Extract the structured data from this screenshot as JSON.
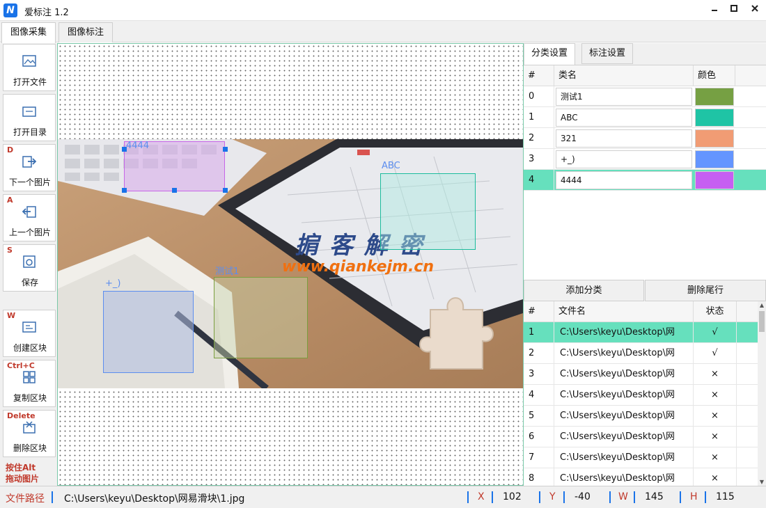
{
  "window": {
    "title": "爱标注 1.2",
    "logo_text": "N"
  },
  "mode_tabs": [
    "图像采集",
    "图像标注"
  ],
  "toolbar": {
    "open_file": "打开文件",
    "open_dir": "打开目录",
    "next_image": {
      "key": "D",
      "label": "下一个图片"
    },
    "prev_image": {
      "key": "A",
      "label": "上一个图片"
    },
    "save": {
      "key": "S",
      "label": "保存"
    },
    "create_box": {
      "key": "W",
      "label": "创建区块"
    },
    "copy_box": {
      "key": "Ctrl+C",
      "label": "复制区块"
    },
    "delete_box": {
      "key": "Delete",
      "label": "删除区块"
    },
    "alt_hint_line1": "按住Alt",
    "alt_hint_line2": "拖动图片"
  },
  "image_overlay": {
    "watermark_title": "掮 客 解 密",
    "watermark_url": "www.qiankejm.cn"
  },
  "annotations": [
    {
      "label": "4444",
      "color": "#c765e8"
    },
    {
      "label": "ABC",
      "color": "#1abc9c"
    },
    {
      "label": "测试1",
      "color": "#7a9e3e"
    },
    {
      "label": "+_)",
      "color": "#5b8def"
    }
  ],
  "panel": {
    "tabs": [
      "分类设置",
      "标注设置"
    ],
    "class_headers": [
      "#",
      "类名",
      "颜色"
    ],
    "classes": [
      {
        "num": "0",
        "name": "测试1",
        "color": "#76a043"
      },
      {
        "num": "1",
        "name": "ABC",
        "color": "#1fc4a5"
      },
      {
        "num": "2",
        "name": "321",
        "color": "#f19c74"
      },
      {
        "num": "3",
        "name": "+_)",
        "color": "#6495ff"
      },
      {
        "num": "4",
        "name": "4444",
        "color": "#c65ff2"
      }
    ],
    "add_class": "添加分类",
    "delete_last": "删除尾行",
    "file_headers": [
      "#",
      "文件名",
      "状态"
    ],
    "files": [
      {
        "num": "1",
        "name": "C:\\Users\\keyu\\Desktop\\网",
        "status": "√"
      },
      {
        "num": "2",
        "name": "C:\\Users\\keyu\\Desktop\\网",
        "status": "√"
      },
      {
        "num": "3",
        "name": "C:\\Users\\keyu\\Desktop\\网",
        "status": "×"
      },
      {
        "num": "4",
        "name": "C:\\Users\\keyu\\Desktop\\网",
        "status": "×"
      },
      {
        "num": "5",
        "name": "C:\\Users\\keyu\\Desktop\\网",
        "status": "×"
      },
      {
        "num": "6",
        "name": "C:\\Users\\keyu\\Desktop\\网",
        "status": "×"
      },
      {
        "num": "7",
        "name": "C:\\Users\\keyu\\Desktop\\网",
        "status": "×"
      },
      {
        "num": "8",
        "name": "C:\\Users\\keyu\\Desktop\\网",
        "status": "×"
      }
    ]
  },
  "status": {
    "path_label": "文件路径",
    "path_value": "C:\\Users\\keyu\\Desktop\\网易滑块\\1.jpg",
    "x_label": "X",
    "x_value": "102",
    "y_label": "Y",
    "y_value": "-40",
    "w_label": "W",
    "w_value": "145",
    "h_label": "H",
    "h_value": "115"
  }
}
